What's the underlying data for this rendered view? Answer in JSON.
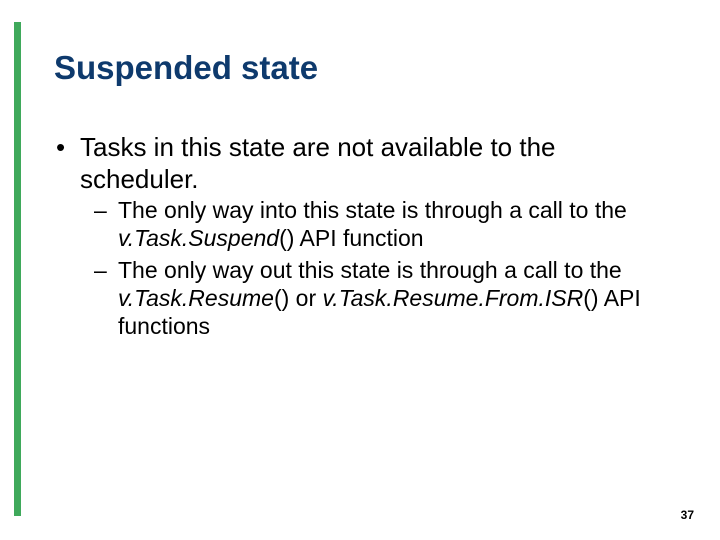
{
  "title": "Suspended state",
  "bullet1": "Tasks in this state are not available to the scheduler.",
  "sub1_pre": "The only way into this state is through a call to the ",
  "sub1_api": "v.Task.Suspend",
  "sub1_post": "() API function",
  "sub2_pre": "The only way out this state is through a call to the ",
  "sub2_api1": "v.Task.Resume",
  "sub2_mid": "() or ",
  "sub2_api2": "v.Task.Resume.From.ISR",
  "sub2_post": "() API functions",
  "page": "37"
}
